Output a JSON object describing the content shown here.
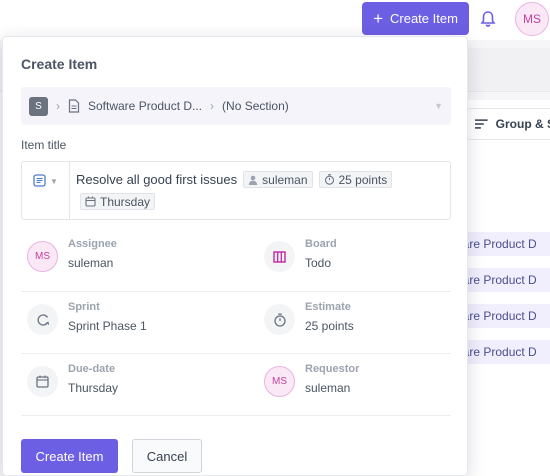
{
  "topbar": {
    "create_button": "Create Item",
    "avatar_initials": "MS"
  },
  "background": {
    "group_button": "Group & S",
    "rows": [
      "ware Product D",
      "ware Product D",
      "ware Product D",
      "ware Product D"
    ]
  },
  "modal": {
    "title": "Create Item",
    "breadcrumb": {
      "space_initial": "S",
      "project": "Software Product D...",
      "section": "(No Section)"
    },
    "item_title_label": "Item title",
    "item_title_text": "Resolve all good first issues",
    "chips": {
      "assignee": "suleman",
      "points": "25 points",
      "due": "Thursday"
    },
    "properties": {
      "assignee": {
        "label": "Assignee",
        "value": "suleman",
        "initials": "MS"
      },
      "board": {
        "label": "Board",
        "value": "Todo"
      },
      "sprint": {
        "label": "Sprint",
        "value": "Sprint Phase 1"
      },
      "estimate": {
        "label": "Estimate",
        "value": "25 points"
      },
      "due_date": {
        "label": "Due-date",
        "value": "Thursday"
      },
      "requestor": {
        "label": "Requestor",
        "value": "suleman",
        "initials": "MS"
      }
    },
    "create_button": "Create Item",
    "cancel_button": "Cancel"
  },
  "colors": {
    "accent": "#6d5fe3",
    "board_icon": "#c026a3",
    "avatar_text": "#c2409f"
  }
}
